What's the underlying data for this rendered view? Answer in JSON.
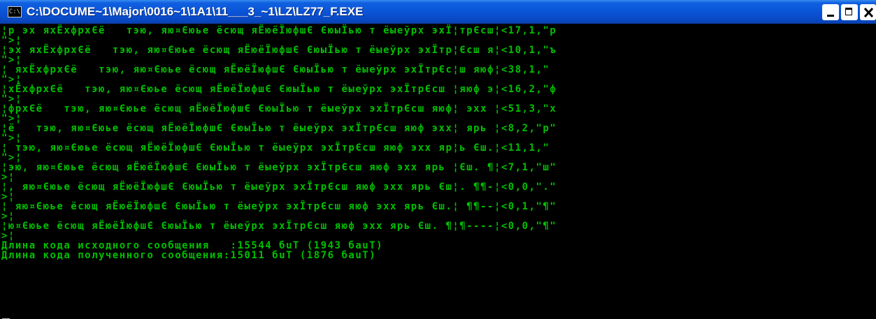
{
  "window": {
    "title": "C:\\DOCUME~1\\Major\\0016~1\\1A1\\11___3_~1\\LZ\\LZ77_F.EXE",
    "icon_name": "console-app-icon",
    "icon_glyph": "C:\\",
    "colors": {
      "titlebar": "#0a52d6",
      "console_bg": "#000000",
      "console_text": "#00c000"
    }
  },
  "console": {
    "lines": [
      "¦р эх яхЁхфрхЄё   тэю, яю¤Єюье ёсющ яЁюёЇюфшЄ ЄюыЇью т ёыеўрх эхЇ¦трЄсш¦<17,1,\"р",
      "\">¦",
      "¦эх яхЁхфрхЄё   тэю, яю¤Єюье ёсющ яЁюёЇюфшЄ ЄюыЇью т ёыеўрх эхЇтр¦Єсш я¦<10,1,\"ъ",
      "\">¦",
      "¦ яхЁхфрхЄё   тэю, яю¤Єюье ёсющ яЁюёЇюфшЄ ЄюыЇью т ёыеўрх эхЇтрЄс¦ш яюф¦<38,1,\" ",
      "\">¦",
      "¦хЁхфрхЄё   тэю, яю¤Єюье ёсющ яЁюёЇюфшЄ ЄюыЇью т ёыеўрх эхЇтрЄсш ¦яюф э¦<16,2,\"ф",
      "\">¦",
      "¦фрхЄё   тэю, яю¤Єюье ёсющ яЁюёЇюфшЄ ЄюыЇью т ёыеўрх эхЇтрЄсш яюф¦ эхх ¦<51,3,\"х",
      "\">¦",
      "¦ё   тэю, яю¤Єюье ёсющ яЁюёЇюфшЄ ЄюыЇью т ёыеўрх эхЇтрЄсш яюф эхх¦ ярь ¦<8,2,\"р\"",
      "\">¦",
      "¦ тэю, яю¤Єюье ёсющ яЁюёЇюфшЄ ЄюыЇью т ёыеўрх эхЇтрЄсш яюф эхх яр¦ь Єш.¦<11,1,\" ",
      "\">¦",
      "¦эю, яю¤Єюье ёсющ яЁюёЇюфшЄ ЄюыЇью т ёыеўрх эхЇтрЄсш яюф эхх ярь ¦Єш. ¶¦<7,1,\"ш\"",
      ">¦",
      "¦, яю¤Єюье ёсющ яЁюёЇюфшЄ ЄюыЇью т ёыеўрх эхЇтрЄсш яюф эхх ярь Єш¦. ¶¶-¦<0,0,\".\"",
      ">¦",
      "¦ яю¤Єюье ёсющ яЁюёЇюфшЄ ЄюыЇью т ёыеўрх эхЇтрЄсш яюф эхх ярь Єш.¦ ¶¶--¦<0,1,\"¶\"",
      ">¦",
      "¦ю¤Єюье ёсющ яЁюёЇюфшЄ ЄюыЇью т ёыеўрх эхЇтрЄсш яюф эхх ярь Єш. ¶¦¶----¦<0,0,\"¶\"",
      ">¦",
      "Длина кода исходного сообщения   :15544 бuТ (1943 баuТ)",
      "Длина кода полученного сообщения:15011 бuТ (1876 баuТ)"
    ]
  }
}
